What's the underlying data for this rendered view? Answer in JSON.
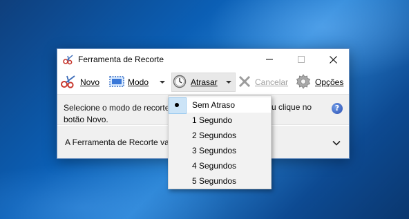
{
  "window": {
    "title": "Ferramenta de Recorte"
  },
  "toolbar": {
    "novo_label": "Novo",
    "modo_label": "Modo",
    "atrasar_label": "Atrasar",
    "cancelar_label": "Cancelar",
    "opcoes_label": "Opções"
  },
  "info": {
    "line1": "Selecione o modo de recorte",
    "line1_right": "u clique no",
    "line2": "botão Novo.",
    "help_glyph": "?"
  },
  "footer": {
    "text": "A Ferramenta de Recorte vai"
  },
  "delay_menu": {
    "selected_index": 0,
    "items": [
      {
        "label": "Sem Atraso"
      },
      {
        "label": "1 Segundo"
      },
      {
        "label": "2 Segundos"
      },
      {
        "label": "3 Segundos"
      },
      {
        "label": "4 Segundos"
      },
      {
        "label": "5 Segundos"
      }
    ]
  },
  "icons": {
    "title": "scissors-icon",
    "novo": "scissors-icon",
    "modo": "rectangle-snip-icon",
    "atrasar": "clock-icon",
    "cancelar": "x-icon",
    "opcoes": "gear-icon",
    "help": "help-icon"
  },
  "colors": {
    "window_border": "#6f93c2",
    "menu_selected": "#cce4f7",
    "help_blue": "#2a4fb3",
    "disabled_text": "#a0a0a0"
  }
}
